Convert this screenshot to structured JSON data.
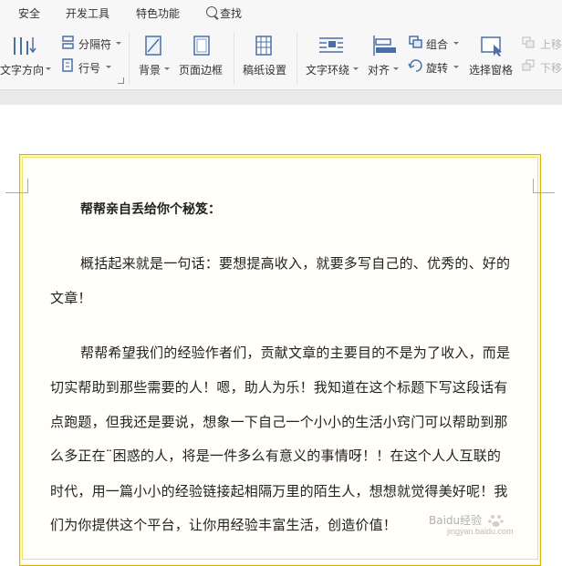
{
  "menu": {
    "items": [
      "安全",
      "开发工具",
      "特色功能"
    ],
    "search_label": "查找"
  },
  "ribbon": {
    "text_direction": "文字方向",
    "separator": "分隔符",
    "line_number": "行号",
    "background": "背景",
    "page_border": "页面边框",
    "manuscript": "稿纸设置",
    "text_wrap": "文字环绕",
    "align": "对齐",
    "group": "组合",
    "rotate": "旋转",
    "selection_pane": "选择窗格",
    "bring_forward": "上移",
    "send_backward": "下移"
  },
  "document": {
    "title": "帮帮亲自丢给你个秘笈：",
    "lines": [
      "概括起来就是一句话：要想提高收入，就要多写自己的、优秀的、好的",
      "文章！",
      "帮帮希望我们的经验作者们，贡献文章的主要目的不是为了收入，而是",
      "切实帮助到那些需要的人！嗯，助人为乐！我知道在这个标题下写这段话有",
      "点跑题，但我还是要说，想象一下自己一个小小的生活小窍门可以帮助到那",
      "么多正在¨困惑的人，将是一件多么有意义的事情呀！！在这个人人互联的",
      "时代，用一篇小小的经验链接起相隔万里的陌生人，想想就觉得美好呢！我",
      "们为你提供这个平台，让你用经验丰富生活，创造价值！"
    ]
  },
  "watermark": {
    "text": "Baidu经验",
    "url": "jingyan.baidu.com"
  }
}
